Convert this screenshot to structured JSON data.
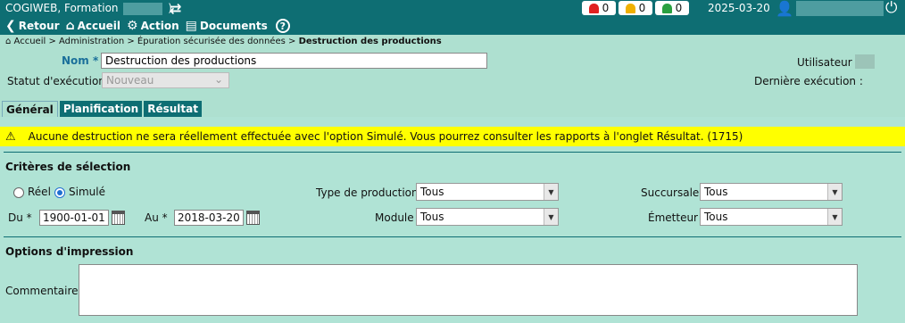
{
  "header": {
    "app_title": "COGIWEB, Formation",
    "title_suffix": ")",
    "nav": {
      "retour": "Retour",
      "accueil": "Accueil",
      "action": "Action",
      "documents": "Documents"
    },
    "alerts": [
      {
        "color": "#e02020",
        "count": "0"
      },
      {
        "color": "#f0b000",
        "count": "0"
      },
      {
        "color": "#2aa040",
        "count": "0"
      }
    ],
    "date": "2025-03-20"
  },
  "breadcrumb": {
    "home": "Accueil",
    "path": " > Administration > Épuration sécurisée des données > ",
    "current": "Destruction des productions"
  },
  "form": {
    "nom_label": "Nom *",
    "nom_value": "Destruction des productions",
    "statut_label": "Statut d'exécution",
    "statut_value": "Nouveau",
    "utilisateur_label": "Utilisateur :",
    "derniere_label": "Dernière exécution :"
  },
  "tabs": [
    {
      "label": "Général",
      "active": true
    },
    {
      "label": "Planification",
      "active": false
    },
    {
      "label": "Résultat",
      "active": false
    }
  ],
  "warning": {
    "text": "Aucune destruction ne sera réellement effectuée avec l'option Simulé. Vous pourrez consulter les rapports à l'onglet Résultat. (1715)"
  },
  "criteria": {
    "title": "Critères de sélection",
    "reel_label": "Réel",
    "simule_label": "Simulé",
    "selected_mode": "Simulé",
    "du_label": "Du *",
    "du_value": "1900-01-01",
    "au_label": "Au *",
    "au_value": "2018-03-20",
    "type_label": "Type de production",
    "type_value": "Tous",
    "module_label": "Module",
    "module_value": "Tous",
    "succursale_label": "Succursale",
    "succursale_value": "Tous",
    "emetteur_label": "Émetteur",
    "emetteur_value": "Tous"
  },
  "print_options": {
    "title": "Options d'impression",
    "commentaire_label": "Commentaire",
    "commentaire_value": ""
  },
  "colors": {
    "header_bg": "#0e6e73",
    "page_bg": "#aee0d0",
    "warning_bg": "#ffff00",
    "label_accent": "#1a6f9a"
  }
}
